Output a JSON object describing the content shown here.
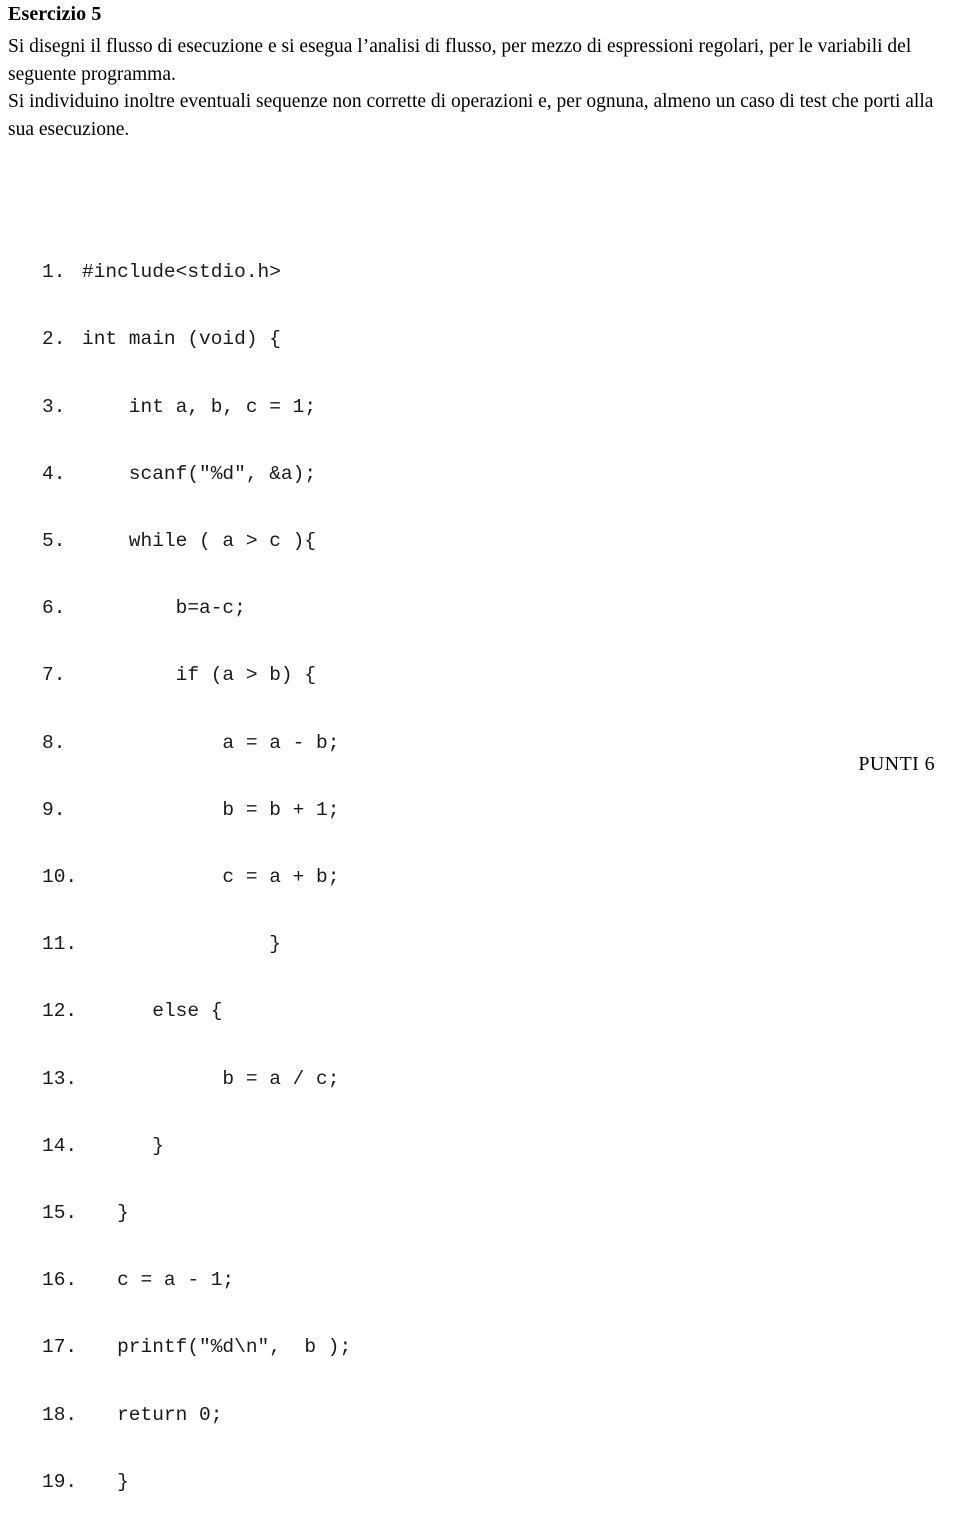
{
  "document": {
    "heading": "Esercizio 5",
    "paragraphs": [
      "Si disegni il flusso di esecuzione e si esegua l’analisi di flusso, per mezzo di espressioni regolari, per le variabili del seguente programma.",
      "Si individuino inoltre eventuali sequenze non corrette di operazioni e, per ognuna, almeno un caso di test che porti alla sua esecuzione."
    ],
    "footer": {
      "points_label": "PUNTI 6"
    }
  },
  "code": {
    "language": "c",
    "lines": [
      {
        "number": "1.",
        "text": "#include<stdio.h>"
      },
      {
        "number": "2.",
        "text": "int main (void) {"
      },
      {
        "number": "3.",
        "text": "    int a, b, c = 1;"
      },
      {
        "number": "4.",
        "text": "    scanf(\"%d\", &a);"
      },
      {
        "number": "5.",
        "text": "    while ( a > c ){"
      },
      {
        "number": "6.",
        "text": "        b=a-c;"
      },
      {
        "number": "7.",
        "text": "        if (a > b) {"
      },
      {
        "number": "8.",
        "text": "            a = a - b;"
      },
      {
        "number": "9.",
        "text": "            b = b + 1;"
      },
      {
        "number": "10.",
        "text": "            c = a + b;"
      },
      {
        "number": "11.",
        "text": "                }"
      },
      {
        "number": "12.",
        "text": "      else {"
      },
      {
        "number": "13.",
        "text": "            b = a / c;"
      },
      {
        "number": "14.",
        "text": "      }"
      },
      {
        "number": "15.",
        "text": "   }"
      },
      {
        "number": "16.",
        "text": "   c = a - 1;"
      },
      {
        "number": "17.",
        "text": "   printf(\"%d\\n\",  b );"
      },
      {
        "number": "18.",
        "text": "   return 0;"
      },
      {
        "number": "19.",
        "text": "   }"
      }
    ]
  }
}
